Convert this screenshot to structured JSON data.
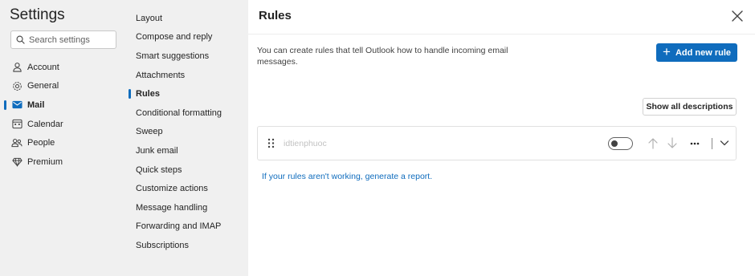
{
  "settings": {
    "title": "Settings",
    "search_placeholder": "Search settings"
  },
  "nav": {
    "items": [
      {
        "label": "Account",
        "icon": "person-icon"
      },
      {
        "label": "General",
        "icon": "gear-icon"
      },
      {
        "label": "Mail",
        "icon": "mail-icon",
        "active": true
      },
      {
        "label": "Calendar",
        "icon": "calendar-icon"
      },
      {
        "label": "People",
        "icon": "people-icon"
      },
      {
        "label": "Premium",
        "icon": "diamond-icon"
      }
    ]
  },
  "mail_nav": {
    "items": [
      {
        "label": "Layout"
      },
      {
        "label": "Compose and reply"
      },
      {
        "label": "Smart suggestions"
      },
      {
        "label": "Attachments"
      },
      {
        "label": "Rules",
        "active": true
      },
      {
        "label": "Conditional formatting"
      },
      {
        "label": "Sweep"
      },
      {
        "label": "Junk email"
      },
      {
        "label": "Quick steps"
      },
      {
        "label": "Customize actions"
      },
      {
        "label": "Message handling"
      },
      {
        "label": "Forwarding and IMAP"
      },
      {
        "label": "Subscriptions"
      }
    ]
  },
  "rules": {
    "title": "Rules",
    "description": "You can create rules that tell Outlook how to handle incoming email messages.",
    "add_button": "Add new rule",
    "show_all_button": "Show all descriptions",
    "rule_list": [
      {
        "name": "idtienphuoc",
        "enabled": false
      }
    ],
    "report_link": "If your rules aren't working, generate a report."
  },
  "colors": {
    "accent": "#0f6cbd",
    "nav_bg": "#f0f0f0",
    "main_bg": "#ffffff"
  }
}
